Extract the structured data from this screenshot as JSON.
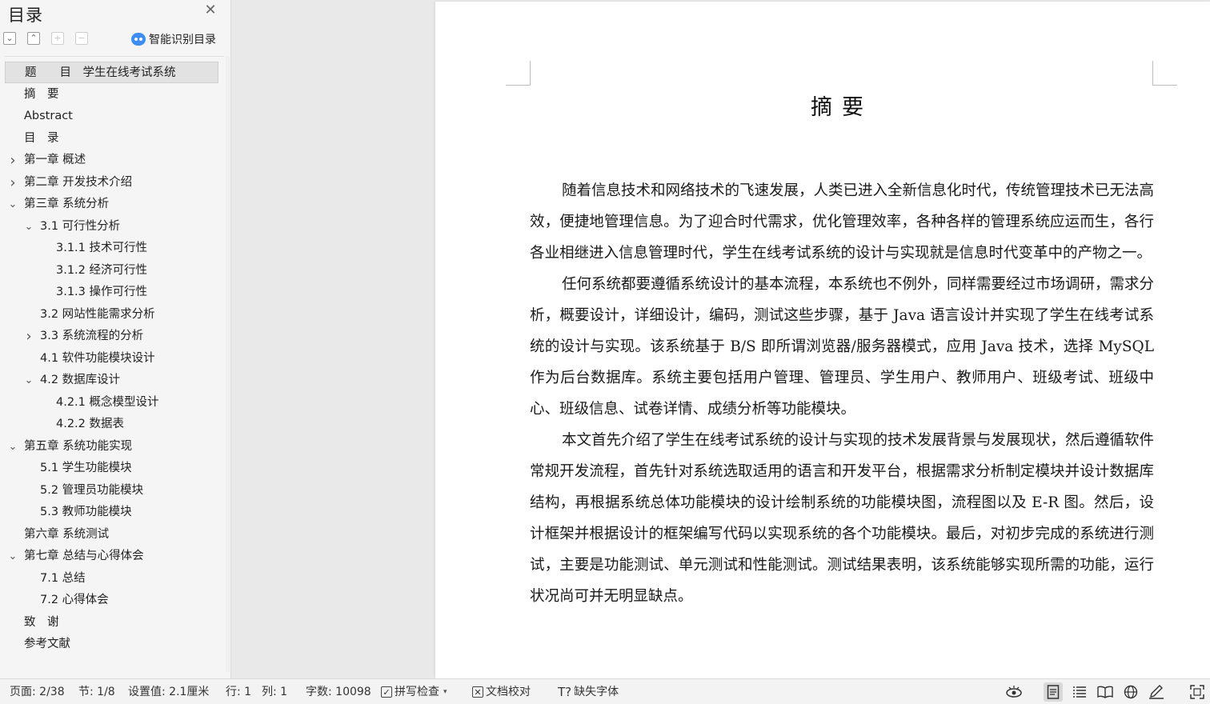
{
  "toc": {
    "title": "目录",
    "smart_toc_label": "智能识别目录",
    "items": [
      {
        "label": "题　　目　学生在线考试系统",
        "level": 0,
        "arrow": "",
        "selected": true
      },
      {
        "label": "摘　要",
        "level": 0,
        "arrow": ""
      },
      {
        "label": "Abstract",
        "level": 0,
        "arrow": ""
      },
      {
        "label": "目　录",
        "level": 0,
        "arrow": ""
      },
      {
        "label": "第一章  概述",
        "level": 0,
        "arrow": "collapsed"
      },
      {
        "label": "第二章  开发技术介绍",
        "level": 0,
        "arrow": "collapsed"
      },
      {
        "label": "第三章  系统分析",
        "level": 0,
        "arrow": "expanded"
      },
      {
        "label": "3.1 可行性分析",
        "level": 1,
        "arrow": "expanded"
      },
      {
        "label": "3.1.1 技术可行性",
        "level": 2,
        "arrow": ""
      },
      {
        "label": "3.1.2 经济可行性",
        "level": 2,
        "arrow": ""
      },
      {
        "label": "3.1.3 操作可行性",
        "level": 2,
        "arrow": ""
      },
      {
        "label": "3.2 网站性能需求分析",
        "level": 1,
        "arrow": ""
      },
      {
        "label": "3.3 系统流程的分析",
        "level": 1,
        "arrow": "collapsed"
      },
      {
        "label": "4.1  软件功能模块设计",
        "level": 1,
        "arrow": ""
      },
      {
        "label": "4.2  数据库设计",
        "level": 1,
        "arrow": "expanded"
      },
      {
        "label": "4.2.1  概念模型设计",
        "level": 2,
        "arrow": ""
      },
      {
        "label": "4.2.2 数据表",
        "level": 2,
        "arrow": ""
      },
      {
        "label": "第五章  系统功能实现",
        "level": 0,
        "arrow": "expanded"
      },
      {
        "label": "5.1 学生功能模块",
        "level": 1,
        "arrow": ""
      },
      {
        "label": "5.2 管理员功能模块",
        "level": 1,
        "arrow": ""
      },
      {
        "label": "5.3 教师功能模块",
        "level": 1,
        "arrow": ""
      },
      {
        "label": "第六章  系统测试",
        "level": 0,
        "arrow": ""
      },
      {
        "label": "第七章  总结与心得体会",
        "level": 0,
        "arrow": "expanded"
      },
      {
        "label": "7.1 总结",
        "level": 1,
        "arrow": ""
      },
      {
        "label": "7.2 心得体会",
        "level": 1,
        "arrow": ""
      },
      {
        "label": "致　谢",
        "level": 0,
        "arrow": ""
      },
      {
        "label": "参考文献",
        "level": 0,
        "arrow": ""
      }
    ]
  },
  "document": {
    "heading": "摘要",
    "paragraphs": [
      "随着信息技术和网络技术的飞速发展，人类已进入全新信息化时代，传统管理技术已无法高效，便捷地管理信息。为了迎合时代需求，优化管理效率，各种各样的管理系统应运而生，各行各业相继进入信息管理时代，学生在线考试系统的设计与实现就是信息时代变革中的产物之一。",
      "任何系统都要遵循系统设计的基本流程，本系统也不例外，同样需要经过市场调研，需求分析，概要设计，详细设计，编码，测试这些步骤，基于 Java 语言设计并实现了学生在线考试系统的设计与实现。该系统基于 B/S 即所谓浏览器/服务器模式，应用 Java 技术，选择 MySQL 作为后台数据库。系统主要包括用户管理、管理员、学生用户、教师用户、班级考试、班级中心、班级信息、试卷详情、成绩分析等功能模块。",
      "本文首先介绍了学生在线考试系统的设计与实现的技术发展背景与发展现状，然后遵循软件常规开发流程，首先针对系统选取适用的语言和开发平台，根据需求分析制定模块并设计数据库结构，再根据系统总体功能模块的设计绘制系统的功能模块图，流程图以及 E-R 图。然后，设计框架并根据设计的框架编写代码以实现系统的各个功能模块。最后，对初步完成的系统进行测试，主要是功能测试、单元测试和性能测试。测试结果表明，该系统能够实现所需的功能，运行状况尚可并无明显缺点。"
    ]
  },
  "status": {
    "page": "页面: 2/38",
    "section": "节: 1/8",
    "setting": "设置值: 2.1厘米",
    "row": "行: 1",
    "col": "列: 1",
    "word_count": "字数: 10098",
    "spell_check": "拼写检查",
    "doc_proof": "文档校对",
    "missing_font": "缺失字体"
  }
}
